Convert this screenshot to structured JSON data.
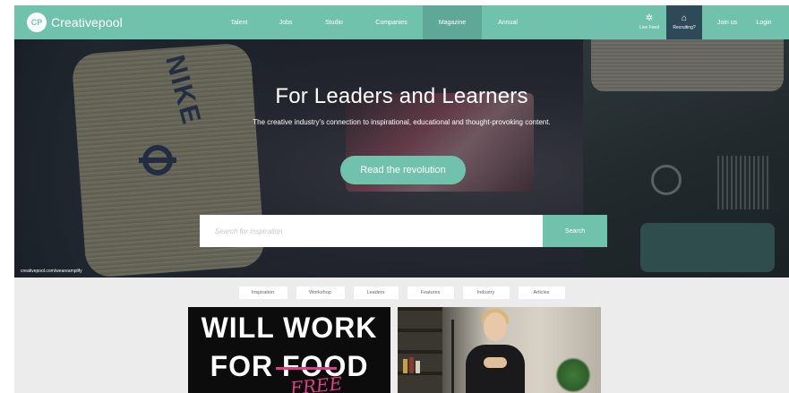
{
  "brand": {
    "logo_mark": "CP",
    "name": "Creativepool"
  },
  "nav": {
    "items": [
      {
        "label": "Talent"
      },
      {
        "label": "Jobs"
      },
      {
        "label": "Studio"
      },
      {
        "label": "Companies"
      },
      {
        "label": "Magazine",
        "active": true
      },
      {
        "label": "Annual"
      }
    ],
    "live_feed": "Live Feed",
    "recruiting": "Recruiting?",
    "join": "Join us",
    "login": "Login"
  },
  "hero": {
    "title": "For Leaders and Learners",
    "subtitle": "The creative industry's connection to inspirational, educational and thought-provoking content.",
    "cta": "Read the revolution",
    "search_placeholder": "Search for inspiration",
    "search_button": "Search",
    "credit": "creativepool.com/weareamplify"
  },
  "tabs": [
    "Inspiration",
    "Workshop",
    "Leaders",
    "Features",
    "Industry",
    "Articles"
  ],
  "cards": {
    "first": {
      "line1": "WILL WORK",
      "line2": "FOR FOOD",
      "overwrite": "FREE"
    }
  },
  "colors": {
    "accent": "#71c2ad",
    "nav_dark": "#2e4a58",
    "pink": "#e03e82"
  },
  "icons": {
    "live_feed": "gear-icon",
    "recruiting": "building-icon"
  }
}
